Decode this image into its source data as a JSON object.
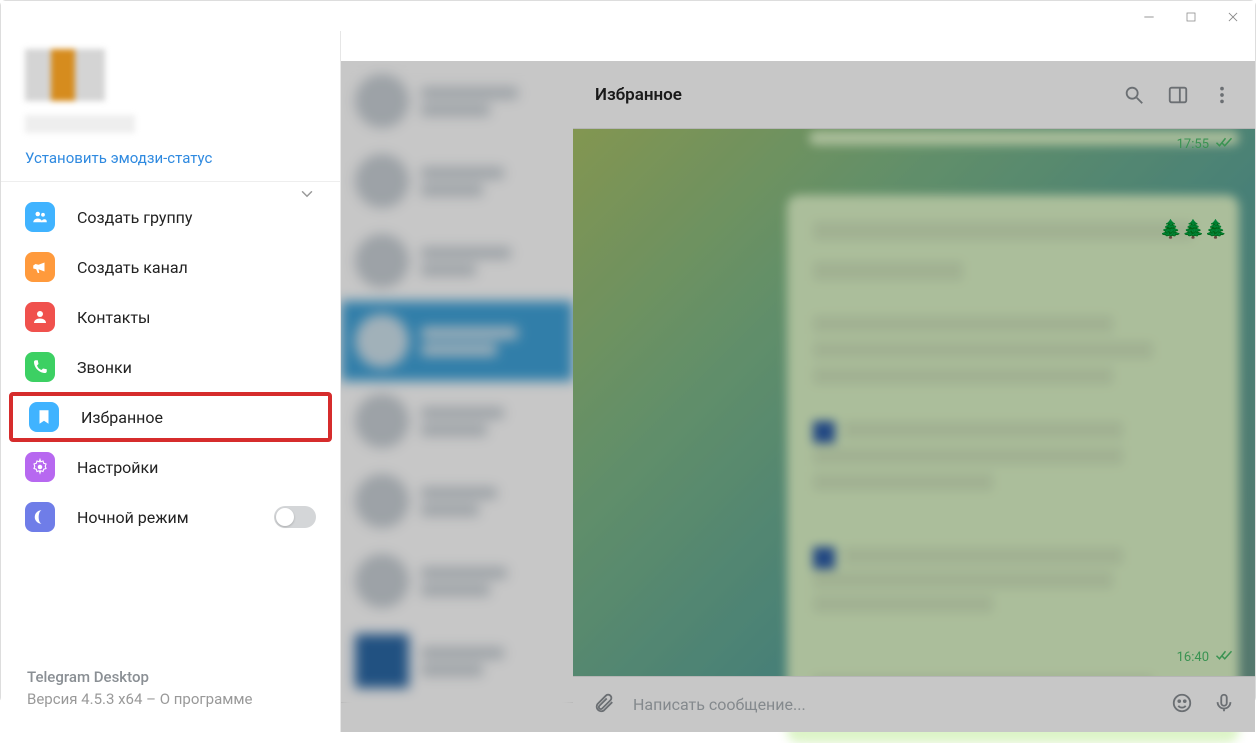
{
  "window": {
    "minimize": "—",
    "maximize": "□",
    "close": "✕"
  },
  "profile": {
    "emoji_status_link": "Установить эмодзи-статус"
  },
  "menu": {
    "create_group": "Создать группу",
    "create_channel": "Создать канал",
    "contacts": "Контакты",
    "calls": "Звонки",
    "saved": "Избранное",
    "settings": "Настройки",
    "night_mode": "Ночной режим"
  },
  "footer": {
    "app_name": "Telegram Desktop",
    "version_line": "Версия 4.5.3 x64 – О программе"
  },
  "chat": {
    "title": "Избранное",
    "time1": "17:55",
    "time2": "16:40",
    "trees": "🌲🌲🌲"
  },
  "input": {
    "placeholder": "Написать сообщение..."
  },
  "icon_colors": {
    "group": "#40b3ff",
    "channel": "#ff9a3c",
    "contacts": "#f0514d",
    "calls": "#3cd063",
    "saved": "#40b3ff",
    "settings": "#b768f0",
    "night": "#6f7de8"
  }
}
